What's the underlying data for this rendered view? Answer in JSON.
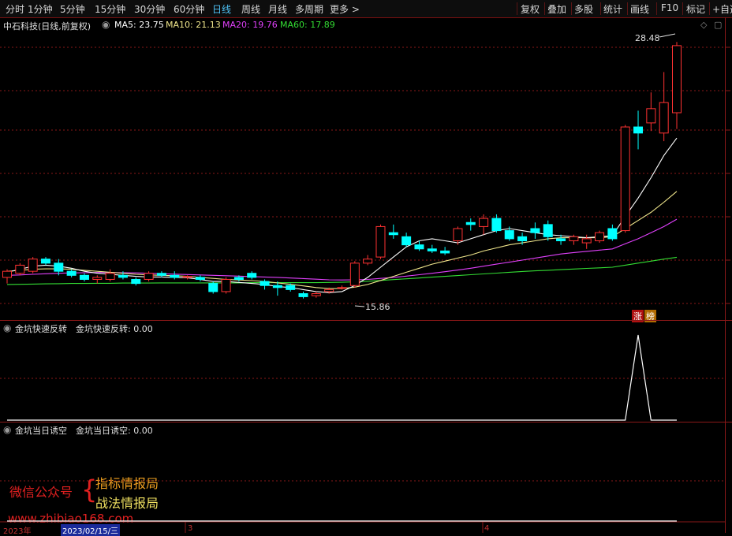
{
  "toolbar": {
    "periods": [
      "分时",
      "1分钟",
      "5分钟",
      "15分钟",
      "30分钟",
      "60分钟",
      "日线",
      "周线",
      "月线",
      "多周期",
      "更多 >"
    ],
    "active_period": "日线",
    "right_buttons": [
      "复权",
      "叠加",
      "多股",
      "统计",
      "画线",
      "F10",
      "标记",
      "+自选"
    ]
  },
  "stock": {
    "title": "中石科技(日线,前复权)",
    "ma": [
      {
        "label": "MA5: 23.75",
        "color": "#ffffff"
      },
      {
        "label": "MA10: 21.13",
        "color": "#f0e68c"
      },
      {
        "label": "MA20: 19.76",
        "color": "#e040fb"
      },
      {
        "label": "MA60: 17.89",
        "color": "#33dd33"
      }
    ],
    "high_label": "28.48",
    "low_label": "15.86",
    "badge_zhang": "涨",
    "badge_bang": "榜"
  },
  "indicator1": {
    "name": "金坑快速反转",
    "value_text": "金坑快速反转: 0.00"
  },
  "indicator2": {
    "name": "金坑当日诱空",
    "value_text": "金坑当日诱空: 0.00"
  },
  "watermark": {
    "left": "微信公众号",
    "line1": "指标情报局",
    "line2": "战法情报局",
    "url": "www.zhibiao168.com"
  },
  "date_axis": {
    "year": "2023年",
    "date": "2023/02/15/三",
    "tick3": "3",
    "tick4": "4"
  },
  "colors": {
    "up": "#ff3232",
    "down": "#00ffff",
    "ma5": "#ffffff",
    "ma10": "#f0e68c",
    "ma20": "#e040fb",
    "ma60": "#33dd33",
    "grid": "#8a1818"
  },
  "chart_data": {
    "type": "candlestick",
    "ohlc": [
      [
        16.9,
        17.3,
        16.6,
        17.2
      ],
      [
        17.1,
        17.6,
        17.0,
        17.5
      ],
      [
        17.2,
        17.9,
        17.1,
        17.8
      ],
      [
        17.8,
        17.9,
        17.5,
        17.6
      ],
      [
        17.6,
        17.8,
        17.0,
        17.2
      ],
      [
        17.2,
        17.3,
        16.9,
        17.0
      ],
      [
        17.0,
        17.1,
        16.7,
        16.8
      ],
      [
        16.8,
        17.0,
        16.6,
        16.9
      ],
      [
        16.8,
        17.3,
        16.7,
        17.1
      ],
      [
        17.0,
        17.2,
        16.8,
        16.9
      ],
      [
        16.8,
        16.9,
        16.5,
        16.6
      ],
      [
        16.8,
        17.2,
        16.7,
        17.1
      ],
      [
        17.1,
        17.2,
        16.9,
        17.0
      ],
      [
        17.0,
        17.2,
        16.8,
        16.9
      ],
      [
        16.9,
        17.0,
        16.8,
        16.95
      ],
      [
        16.9,
        17.0,
        16.7,
        16.8
      ],
      [
        16.6,
        16.7,
        16.1,
        16.2
      ],
      [
        16.2,
        16.9,
        16.1,
        16.8
      ],
      [
        16.9,
        17.0,
        16.7,
        16.8
      ],
      [
        17.1,
        17.2,
        16.8,
        16.9
      ],
      [
        16.7,
        16.8,
        16.3,
        16.5
      ],
      [
        16.5,
        16.7,
        16.0,
        16.4
      ],
      [
        16.5,
        16.6,
        16.2,
        16.3
      ],
      [
        16.1,
        16.2,
        15.86,
        15.95
      ],
      [
        16.0,
        16.2,
        15.9,
        16.1
      ],
      [
        16.2,
        16.4,
        16.1,
        16.3
      ],
      [
        16.4,
        16.5,
        16.3,
        16.4
      ],
      [
        16.5,
        17.7,
        16.4,
        17.6
      ],
      [
        17.6,
        18.0,
        17.5,
        17.8
      ],
      [
        17.9,
        19.5,
        17.8,
        19.4
      ],
      [
        19.1,
        19.5,
        18.8,
        19.0
      ],
      [
        18.9,
        19.1,
        18.4,
        18.5
      ],
      [
        18.5,
        18.7,
        18.2,
        18.3
      ],
      [
        18.3,
        18.5,
        18.1,
        18.2
      ],
      [
        18.2,
        18.4,
        18.0,
        18.1
      ],
      [
        18.7,
        19.4,
        18.5,
        19.3
      ],
      [
        19.6,
        19.8,
        19.2,
        19.5
      ],
      [
        19.4,
        20.0,
        19.0,
        19.8
      ],
      [
        19.8,
        20.0,
        19.1,
        19.2
      ],
      [
        19.2,
        19.4,
        18.7,
        18.8
      ],
      [
        18.9,
        19.1,
        18.5,
        18.7
      ],
      [
        19.3,
        19.6,
        18.8,
        19.1
      ],
      [
        19.5,
        19.7,
        18.7,
        18.9
      ],
      [
        18.8,
        19.0,
        18.5,
        18.7
      ],
      [
        18.7,
        19.0,
        18.5,
        18.9
      ],
      [
        18.6,
        19.0,
        18.3,
        18.8
      ],
      [
        18.7,
        19.2,
        18.6,
        19.1
      ],
      [
        19.3,
        19.5,
        18.7,
        18.8
      ],
      [
        19.2,
        24.4,
        19.1,
        24.3
      ],
      [
        24.3,
        25.1,
        23.2,
        24.0
      ],
      [
        24.5,
        26.0,
        24.1,
        25.2
      ],
      [
        24.0,
        27.0,
        23.6,
        25.5
      ],
      [
        25.0,
        28.48,
        24.2,
        28.3
      ]
    ],
    "ma5": [
      17.15,
      17.3,
      17.45,
      17.5,
      17.45,
      17.35,
      17.2,
      17.1,
      17.05,
      17.0,
      16.95,
      16.92,
      16.92,
      16.9,
      16.88,
      16.8,
      16.7,
      16.7,
      16.65,
      16.6,
      16.55,
      16.45,
      16.4,
      16.3,
      16.2,
      16.15,
      16.2,
      16.5,
      16.9,
      17.4,
      17.9,
      18.4,
      18.7,
      18.8,
      18.7,
      18.6,
      18.8,
      19.0,
      19.2,
      19.3,
      19.2,
      19.1,
      19.0,
      18.95,
      18.9,
      18.85,
      18.9,
      18.95,
      19.9,
      20.8,
      21.8,
      22.9,
      23.75
    ],
    "ma10": [
      17.2,
      17.25,
      17.3,
      17.32,
      17.32,
      17.3,
      17.25,
      17.2,
      17.15,
      17.1,
      17.05,
      17.02,
      17.0,
      16.98,
      16.95,
      16.9,
      16.85,
      16.8,
      16.77,
      16.74,
      16.7,
      16.63,
      16.56,
      16.48,
      16.4,
      16.35,
      16.35,
      16.42,
      16.55,
      16.75,
      16.95,
      17.15,
      17.35,
      17.55,
      17.7,
      17.85,
      18.0,
      18.2,
      18.35,
      18.5,
      18.6,
      18.7,
      18.8,
      18.85,
      18.85,
      18.85,
      18.85,
      18.9,
      19.3,
      19.7,
      20.1,
      20.6,
      21.13
    ],
    "ma20": [
      17.0,
      17.02,
      17.05,
      17.08,
      17.1,
      17.12,
      17.13,
      17.14,
      17.14,
      17.13,
      17.12,
      17.1,
      17.08,
      17.06,
      17.04,
      17.02,
      17.0,
      16.98,
      16.96,
      16.94,
      16.92,
      16.9,
      16.87,
      16.84,
      16.81,
      16.78,
      16.77,
      16.78,
      16.8,
      16.85,
      16.9,
      16.96,
      17.03,
      17.1,
      17.18,
      17.26,
      17.35,
      17.45,
      17.55,
      17.65,
      17.75,
      17.85,
      17.95,
      18.05,
      18.12,
      18.18,
      18.24,
      18.3,
      18.55,
      18.8,
      19.1,
      19.4,
      19.76
    ],
    "ma60": [
      16.55,
      16.56,
      16.57,
      16.58,
      16.59,
      16.6,
      16.6,
      16.61,
      16.61,
      16.62,
      16.62,
      16.62,
      16.63,
      16.63,
      16.63,
      16.63,
      16.63,
      16.63,
      16.63,
      16.64,
      16.64,
      16.64,
      16.64,
      16.64,
      16.64,
      16.65,
      16.66,
      16.68,
      16.71,
      16.75,
      16.79,
      16.83,
      16.87,
      16.91,
      16.95,
      16.99,
      17.03,
      17.07,
      17.11,
      17.15,
      17.19,
      17.22,
      17.25,
      17.28,
      17.31,
      17.34,
      17.37,
      17.4,
      17.5,
      17.6,
      17.7,
      17.8,
      17.89
    ],
    "signal1": [
      0,
      0,
      0,
      0,
      0,
      0,
      0,
      0,
      0,
      0,
      0,
      0,
      0,
      0,
      0,
      0,
      0,
      0,
      0,
      0,
      0,
      0,
      0,
      0,
      0,
      0,
      0,
      0,
      0,
      0,
      0,
      0,
      0,
      0,
      0,
      0,
      0,
      0,
      0,
      0,
      0,
      0,
      0,
      0,
      0,
      0,
      0,
      0,
      0,
      1,
      0,
      0,
      0
    ],
    "signal2": [
      0,
      0,
      0,
      0,
      0,
      0,
      0,
      0,
      0,
      0,
      0,
      0,
      0,
      0,
      0,
      0,
      0,
      0,
      0,
      0,
      0,
      0,
      0,
      0,
      0,
      0,
      0,
      0,
      0,
      0,
      0,
      0,
      0,
      0,
      0,
      0,
      0,
      0,
      0,
      0,
      0,
      0,
      0,
      0,
      0,
      0,
      0,
      0,
      0,
      0,
      0,
      0,
      0
    ]
  }
}
